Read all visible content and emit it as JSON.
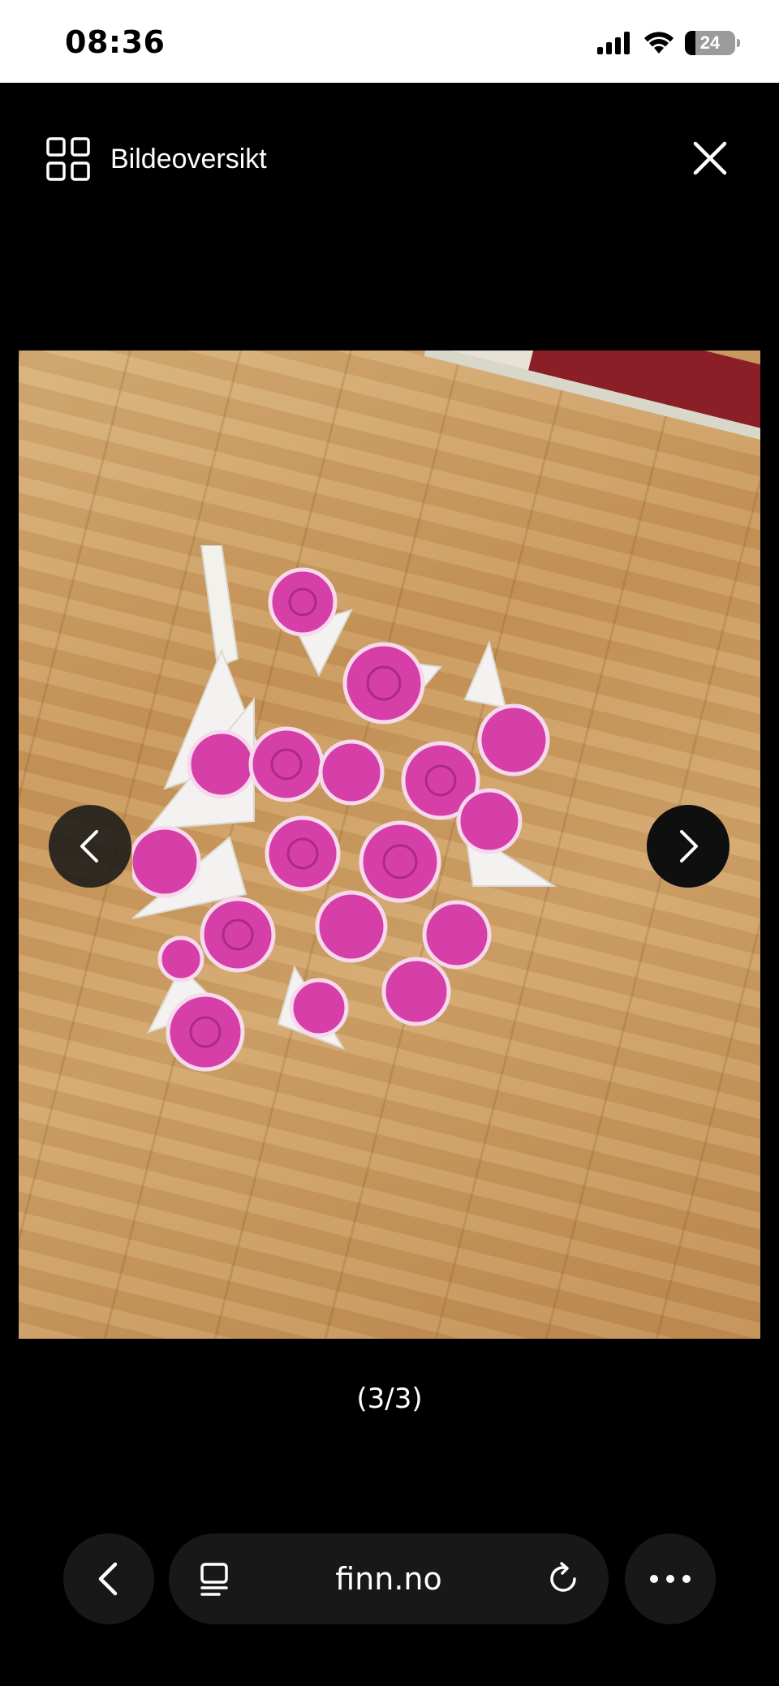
{
  "status_bar": {
    "time": "08:36",
    "battery_level": "24",
    "icons": [
      "cellular-signal-icon",
      "wifi-icon",
      "battery-icon"
    ]
  },
  "header": {
    "overview_label": "Bildeoversikt",
    "overview_icon": "grid-icon",
    "close_icon": "close-icon"
  },
  "viewer": {
    "image_subject": "photo-bouquet",
    "prev_icon": "chevron-left-icon",
    "next_icon": "chevron-right-icon",
    "counter": "(3/3)"
  },
  "browser": {
    "url": "finn.no",
    "back_icon": "chevron-left-icon",
    "tab_icon": "tab-icon",
    "reload_icon": "reload-icon",
    "more_icon": "more-icon"
  },
  "colors": {
    "background": "#000000",
    "status_bar": "#ffffff",
    "control_bg": "#181818",
    "flower_pink": "#d63fa8"
  }
}
